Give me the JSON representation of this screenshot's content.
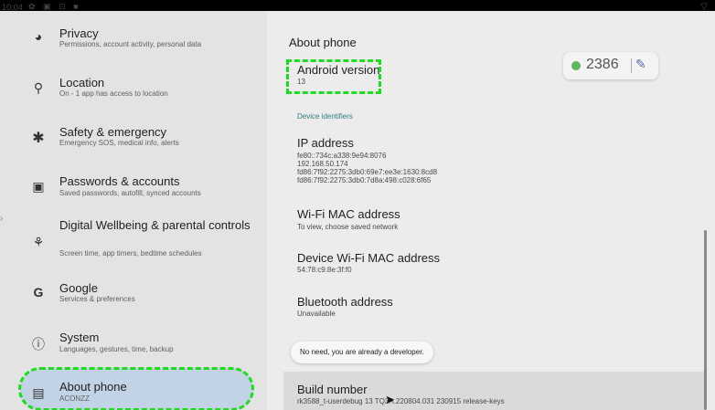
{
  "statusbar": {
    "time": "10:04",
    "icons": "✿ ▣ ⊡ ■",
    "wifi": "▽"
  },
  "nav": [
    {
      "title": "Privacy",
      "sub": "Permissions, account activity, personal data"
    },
    {
      "title": "Location",
      "sub": "On - 1 app has access to location"
    },
    {
      "title": "Safety & emergency",
      "sub": "Emergency SOS, medical info, alerts"
    },
    {
      "title": "Passwords & accounts",
      "sub": "Saved passwords, autofill, synced accounts"
    },
    {
      "title": "Digital Wellbeing & parental controls",
      "sub": "Screen time, app timers, bedtime schedules"
    },
    {
      "title": "Google",
      "sub": "Services & preferences"
    },
    {
      "title": "System",
      "sub": "Languages, gestures, time, backup"
    },
    {
      "title": "About phone",
      "sub": "ACONZZ"
    }
  ],
  "page": {
    "header": "About phone",
    "android_version": {
      "title": "Android version",
      "value": "13"
    },
    "section_label": "Device identifiers",
    "ip": {
      "title": "IP address",
      "lines": [
        "fe80::734c:a338:9e94:8076",
        "192.168.50.174",
        "fd86:7f92:2275:3db0:69e7:ee3e:1630:8cd8",
        "fd86:7f92:2275:3db0:7d8a:498:c028:6f65"
      ]
    },
    "wifi_mac": {
      "title": "Wi-Fi MAC address",
      "sub": "To view, choose saved network"
    },
    "device_wifi_mac": {
      "title": "Device Wi-Fi MAC address",
      "sub": "54:78:c9:8e:3f:f0"
    },
    "bluetooth": {
      "title": "Bluetooth address",
      "sub": "Unavailable"
    },
    "build": {
      "title": "Build number",
      "sub": "rk3588_t-userdebug 13 TQ3A.220804.031 230915 release-keys"
    }
  },
  "toast": "No need, you are already a developer.",
  "badge": {
    "count": "2386",
    "icon": "✎"
  },
  "colors": {
    "highlight": "#1fdc1f",
    "selected_bg": "#c2d3e6",
    "section_label": "#2f7e7a",
    "badge_dot": "#5cb85c"
  }
}
